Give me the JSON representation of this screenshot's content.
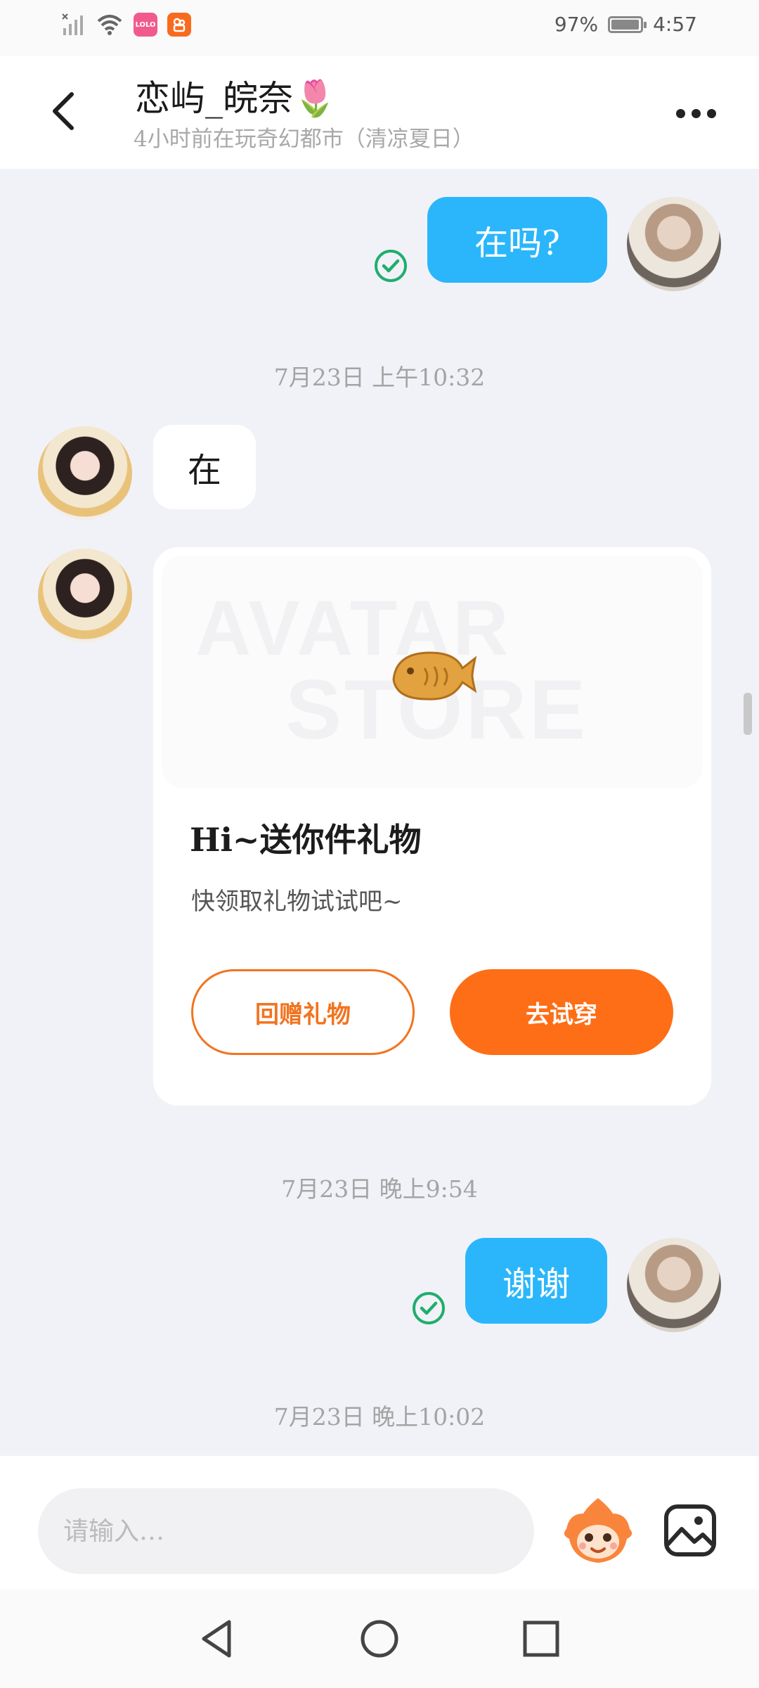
{
  "status_bar": {
    "battery_percent": "97%",
    "battery_level": 0.97,
    "time": "4:57",
    "app_badge_1_text": "LOLO",
    "app_badge_1_color": "#f15a8c",
    "app_badge_2_color": "#f86b1e"
  },
  "header": {
    "title": "恋屿_皖奈🌷",
    "subtitle": "4小时前在玩奇幻都市（清凉夏日）",
    "back_icon": "chevron-left-icon",
    "more_icon": "more-dots-icon"
  },
  "messages": {
    "msg1": {
      "text": "在吗?",
      "status_icon": "read-check-icon"
    },
    "timestamp1": "7月23日  上午10:32",
    "msg2": {
      "text": "在"
    },
    "gift": {
      "title": "Hi~送你件礼物",
      "description": "快领取礼物试试吧~",
      "return_button": "回赠礼物",
      "tryon_button": "去试穿",
      "watermark_line1": "AVATAR",
      "watermark_line2": "STORE"
    },
    "timestamp2": "7月23日  晚上9:54",
    "msg3": {
      "text": "谢谢",
      "status_icon": "read-check-icon"
    },
    "timestamp3": "7月23日  晚上10:02"
  },
  "input": {
    "placeholder": "请输入…"
  },
  "colors": {
    "accent_blue": "#2bb6fb",
    "accent_orange": "#fd6e16",
    "read_green": "#1fae6c",
    "background": "#f1f2f7"
  }
}
